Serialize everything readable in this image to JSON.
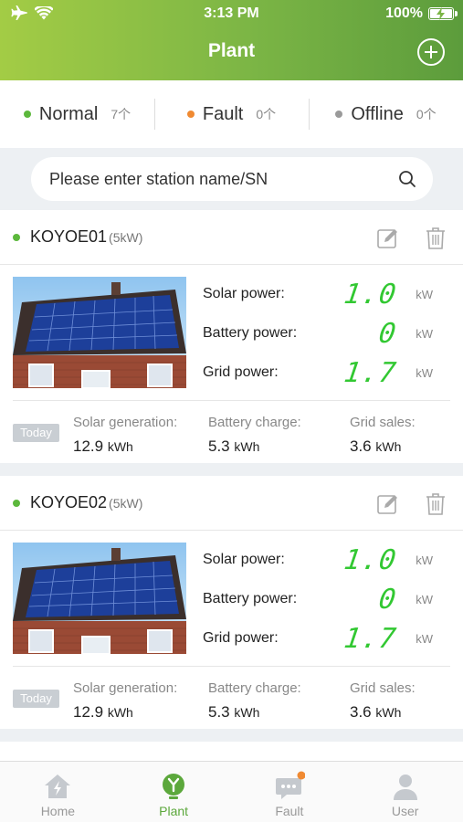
{
  "status_bar": {
    "time": "3:13 PM",
    "battery": "100%"
  },
  "header": {
    "title": "Plant"
  },
  "filters": [
    {
      "label": "Normal",
      "count": "7个",
      "color": "#5cb83c"
    },
    {
      "label": "Fault",
      "count": "0个",
      "color": "#f08a32"
    },
    {
      "label": "Offline",
      "count": "0个",
      "color": "#9a9a9a"
    }
  ],
  "search": {
    "placeholder": "Please enter station name/SN"
  },
  "stations": [
    {
      "name": "KOYOE01",
      "capacity": "(5kW)",
      "solar_label": "Solar power:",
      "solar_value": "1.0",
      "solar_unit": "kW",
      "battery_label": "Battery power:",
      "battery_value": "0",
      "battery_unit": "kW",
      "grid_label": "Grid power:",
      "grid_value": "1.7",
      "grid_unit": "kW",
      "today_label": "Today",
      "gen_label": "Solar generation:",
      "gen_value": "12.9",
      "gen_unit": "kWh",
      "charge_label": "Battery charge:",
      "charge_value": "5.3",
      "charge_unit": "kWh",
      "sales_label": "Grid sales:",
      "sales_value": "3.6",
      "sales_unit": "kWh"
    },
    {
      "name": "KOYOE02",
      "capacity": "(5kW)",
      "solar_label": "Solar power:",
      "solar_value": "1.0",
      "solar_unit": "kW",
      "battery_label": "Battery power:",
      "battery_value": "0",
      "battery_unit": "kW",
      "grid_label": "Grid power:",
      "grid_value": "1.7",
      "grid_unit": "kW",
      "today_label": "Today",
      "gen_label": "Solar generation:",
      "gen_value": "12.9",
      "gen_unit": "kWh",
      "charge_label": "Battery charge:",
      "charge_value": "5.3",
      "charge_unit": "kWh",
      "sales_label": "Grid sales:",
      "sales_value": "3.6",
      "sales_unit": "kWh"
    }
  ],
  "tabs": [
    {
      "label": "Home",
      "icon": "home-icon"
    },
    {
      "label": "Plant",
      "icon": "plant-icon"
    },
    {
      "label": "Fault",
      "icon": "fault-icon"
    },
    {
      "label": "User",
      "icon": "user-icon"
    }
  ],
  "colors": {
    "accent": "#7bb545",
    "normal": "#5cb83c",
    "fault": "#f08a32",
    "offline": "#9a9a9a",
    "digits": "#32c832"
  }
}
